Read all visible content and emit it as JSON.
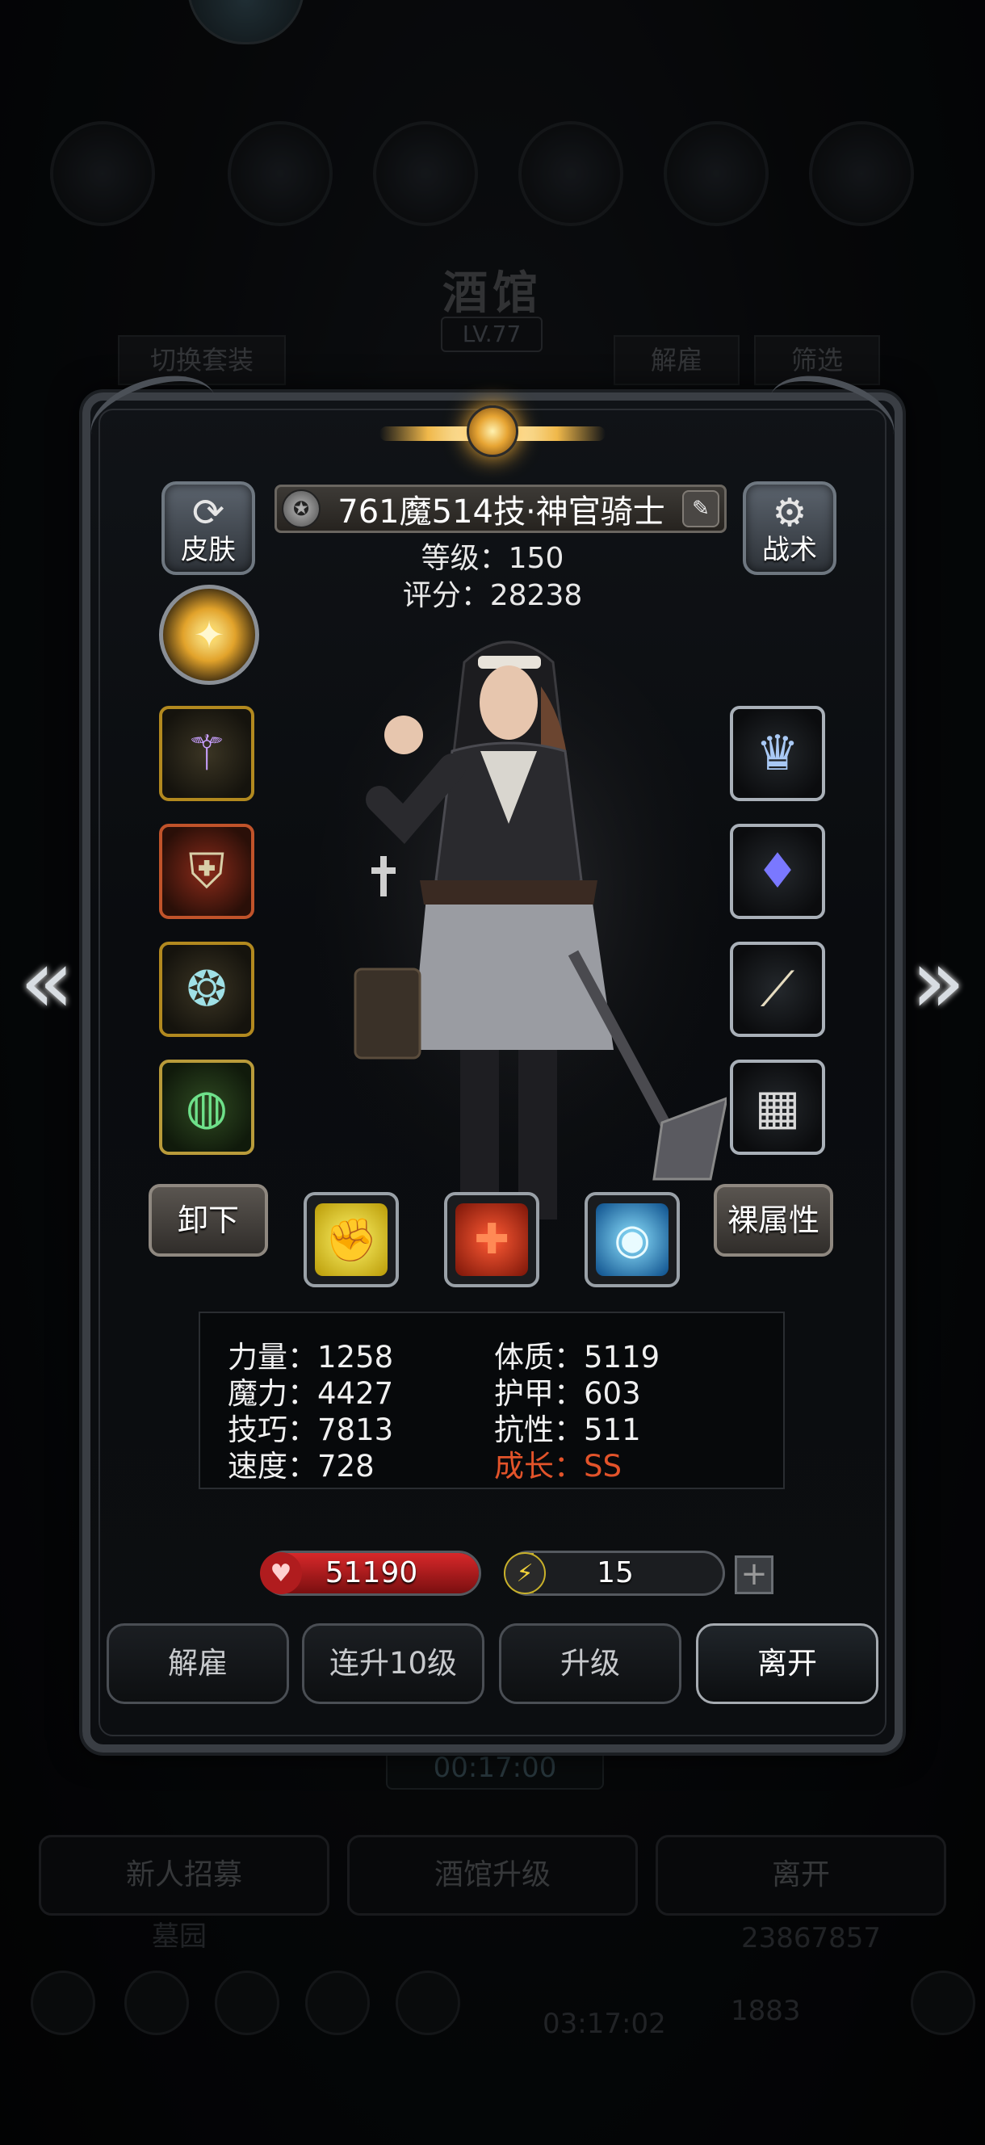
{
  "background": {
    "title": "酒馆",
    "level": "LV.77",
    "switch_outfit": "切换套装",
    "dismiss": "解雇",
    "filter": "筛选",
    "timer": "00:17:00",
    "buttons": [
      "新人招募",
      "酒馆升级",
      "离开"
    ],
    "cemetery": "墓园",
    "gold": "23867857",
    "gems": "1883",
    "gift_timer": "03:17:02"
  },
  "hero": {
    "name": "761魔514技·神官骑士",
    "level_line": "等级：150",
    "score_line": "评分：28238",
    "skin_label": "皮肤",
    "tactics_label": "战术",
    "emblem_text": "✦",
    "unequip_label": "卸下",
    "base_attr_label": "裸属性"
  },
  "equipment": {
    "left": [
      "staff-icon",
      "armor-icon",
      "amulet-icon",
      "ring-icon"
    ],
    "right": [
      "tiara-icon",
      "crystal-icon",
      "bone-icon",
      "chainmail-icon"
    ]
  },
  "skills": [
    {
      "name": "fist-skill-icon",
      "color": "#e6d21a"
    },
    {
      "name": "heal-cross-skill-icon",
      "color": "#d9361c"
    },
    {
      "name": "eye-skill-icon",
      "color": "#2a8fd8"
    }
  ],
  "stats": {
    "strength": "力量：1258",
    "constitution": "体质：5119",
    "magic": "魔力：4427",
    "armor": "护甲：603",
    "skill": "技巧：7813",
    "resistance": "抗性：511",
    "speed": "速度：728",
    "growth": "成长：SS"
  },
  "bars": {
    "hp": "51190",
    "hp_fraction": 1.0,
    "energy": "15",
    "energy_fraction": 0.12,
    "hp_color": "#d8282a",
    "energy_color": "#c9b12a"
  },
  "actions": {
    "dismiss": "解雇",
    "upgrade10": "连升10级",
    "upgrade": "升级",
    "leave": "离开"
  },
  "nav": {
    "prev": "«",
    "next": "»"
  }
}
